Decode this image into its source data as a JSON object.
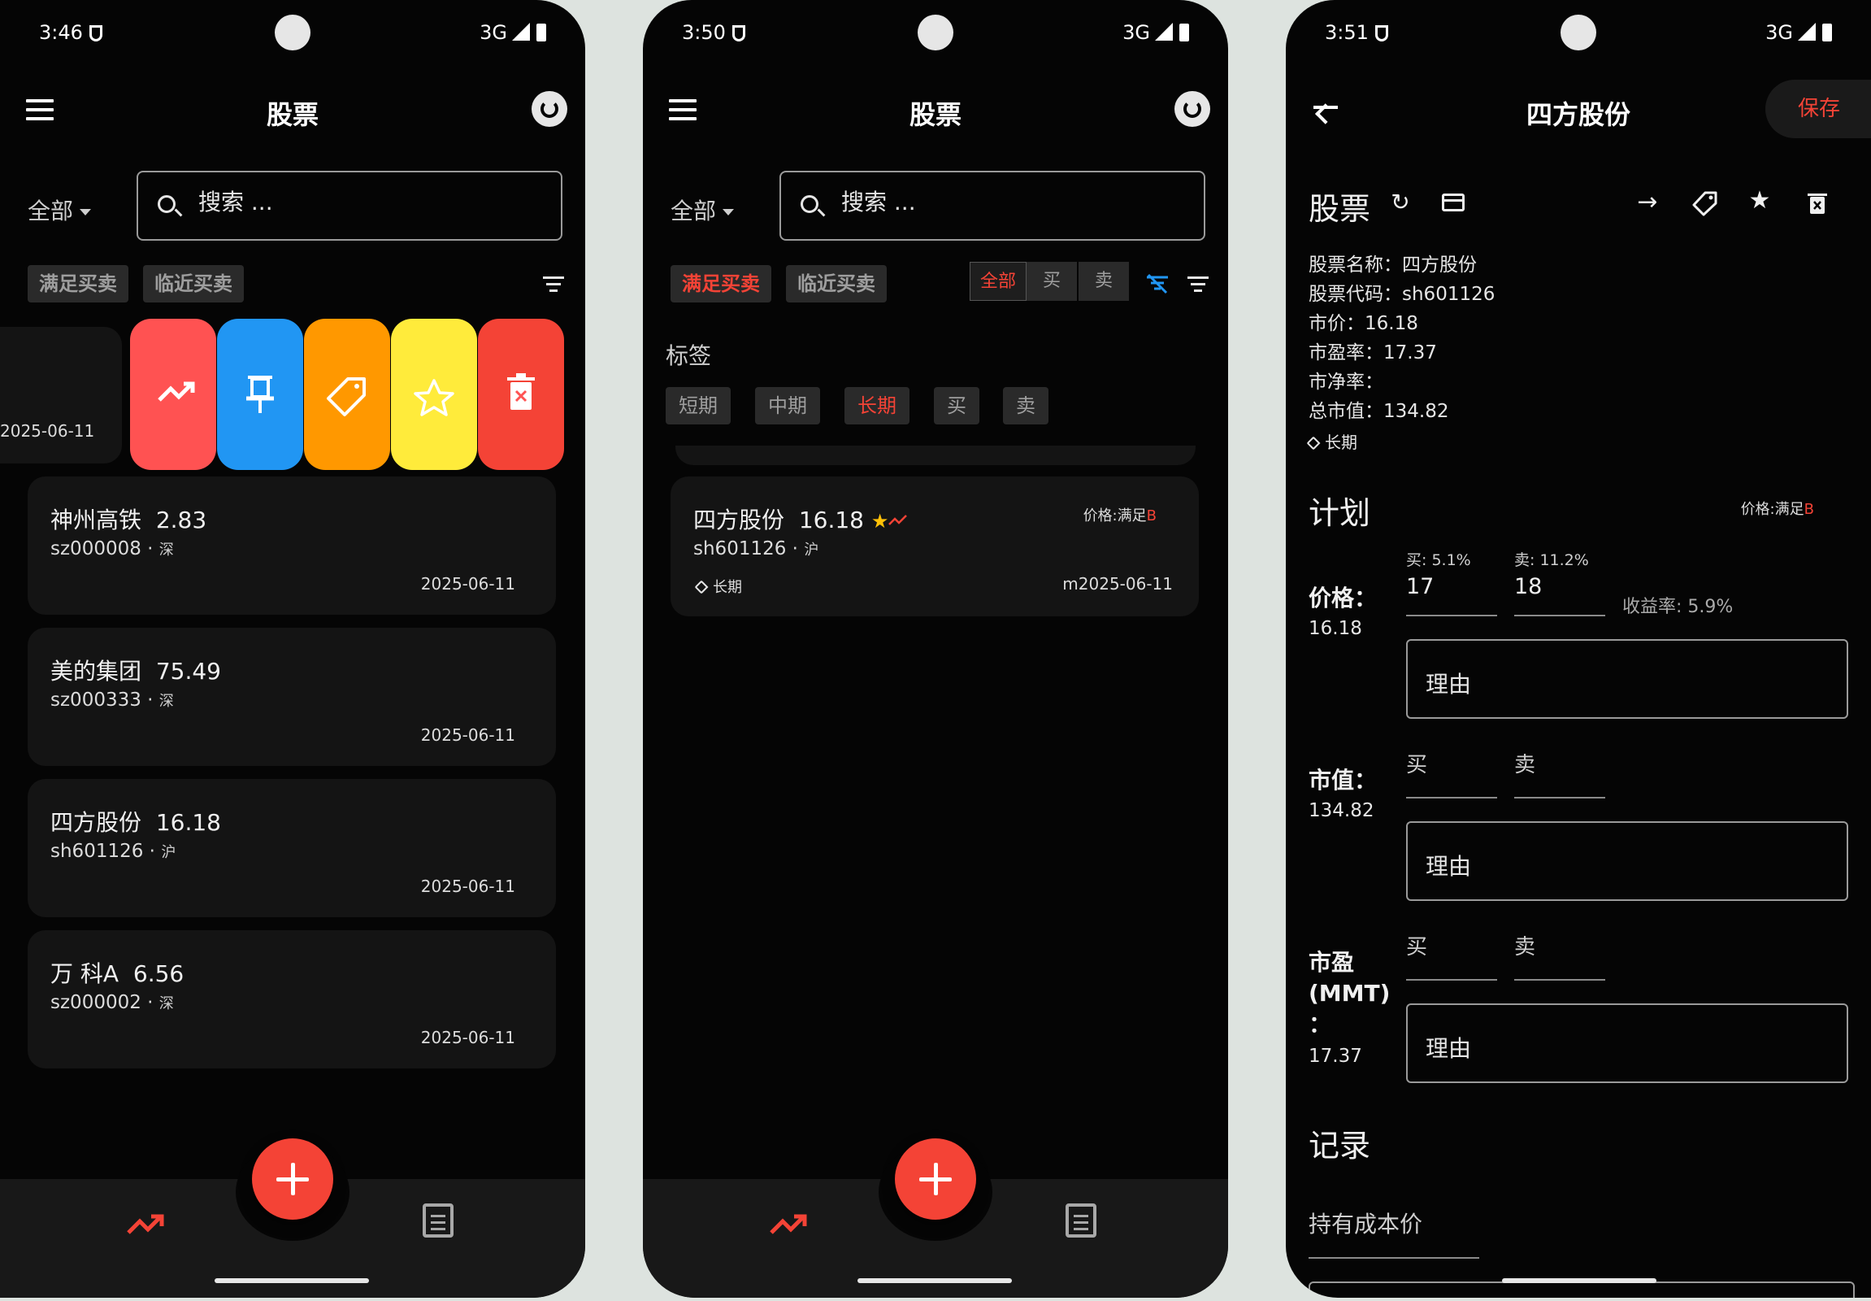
{
  "status": {
    "network": "3G"
  },
  "screens": [
    {
      "time": "3:46",
      "title": "股票",
      "scope": "全部",
      "search_placeholder": "搜索 ...",
      "chips": [
        "满足买卖",
        "临近买卖"
      ],
      "swiped_date": "2025-06-11",
      "actions": [
        {
          "name": "trend-action-button",
          "icon": "trending-up-icon",
          "color": "#ff5252"
        },
        {
          "name": "pin-action-button",
          "icon": "pin-icon",
          "color": "#2196f3"
        },
        {
          "name": "tag-action-button",
          "icon": "tag-icon",
          "color": "#ff9800"
        },
        {
          "name": "favorite-action-button",
          "icon": "star-icon",
          "color": "#ffeb3b"
        },
        {
          "name": "delete-action-button",
          "icon": "delete-icon",
          "color": "#f44336"
        }
      ],
      "stocks": [
        {
          "name": "神州高铁",
          "price": "2.83",
          "code": "sz000008",
          "market": "深",
          "date": "2025-06-11"
        },
        {
          "name": "美的集团",
          "price": "75.49",
          "code": "sz000333",
          "market": "深",
          "date": "2025-06-11"
        },
        {
          "name": "四方股份",
          "price": "16.18",
          "code": "sh601126",
          "market": "沪",
          "date": "2025-06-11"
        },
        {
          "name": "万 科A",
          "price": "6.56",
          "code": "sz000002",
          "market": "深",
          "date": "2025-06-11"
        }
      ]
    },
    {
      "time": "3:50",
      "title": "股票",
      "scope": "全部",
      "search_placeholder": "搜索 ...",
      "chips": [
        "满足买卖",
        "临近买卖"
      ],
      "segments": [
        "全部",
        "买",
        "卖"
      ],
      "tags_label": "标签",
      "tags": [
        "短期",
        "中期",
        "长期",
        "买",
        "卖"
      ],
      "stock": {
        "name": "四方股份",
        "price": "16.18",
        "code": "sh601126",
        "market": "沪",
        "tag": "长期",
        "status_prefix": "价格:满足",
        "status_value": "B",
        "date": "m2025-06-11"
      }
    },
    {
      "time": "3:51",
      "title": "四方股份",
      "save": "保存",
      "section_stock": "股票",
      "info": [
        "股票名称：四方股份",
        "股票代码：sh601126",
        " 市价：16.18",
        "市盈率：17.37",
        "市净率：",
        "总市值：134.82"
      ],
      "tag": "长期",
      "section_plan": "计划",
      "plan_status_prefix": "价格:满足",
      "plan_status_value": "B",
      "price": {
        "label": "价格：",
        "value": "16.18",
        "buy_label": "买: 5.1%",
        "buy": "17",
        "sell_label": "卖: 11.2%",
        "sell": "18",
        "yield": "收益率: 5.9%",
        "reason": "理由"
      },
      "market_value": {
        "label": "市值：",
        "value": "134.82",
        "buy_label": "买",
        "sell_label": "卖",
        "reason": "理由"
      },
      "pe": {
        "label_1": "市盈",
        "label_2": "(MMT)",
        "label_3": "：",
        "value": "17.37",
        "buy_label": "买",
        "sell_label": "卖",
        "reason": "理由"
      },
      "section_record": "记录",
      "cost_label": "持有成本价"
    }
  ]
}
